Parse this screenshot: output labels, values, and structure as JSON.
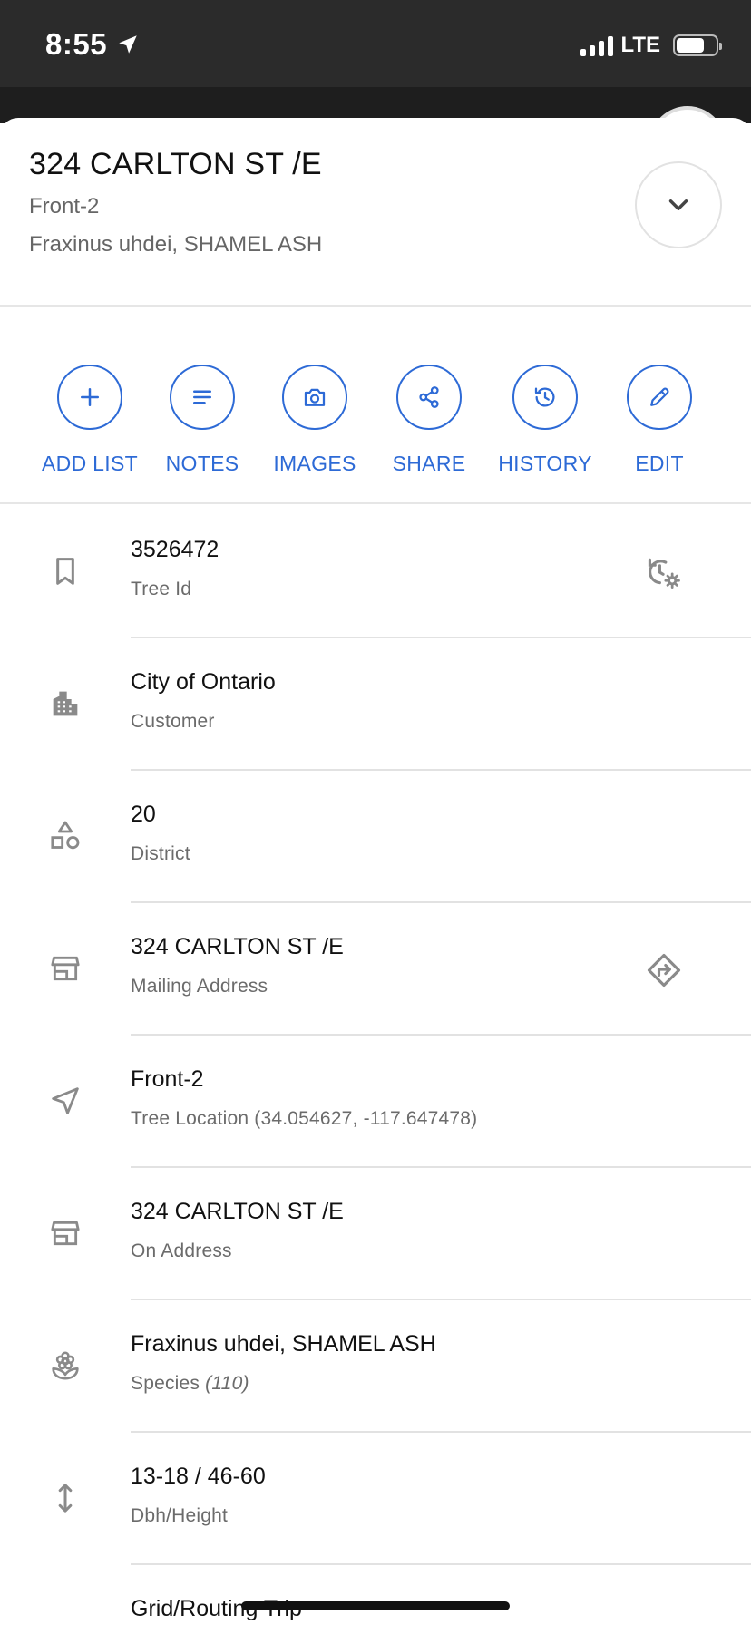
{
  "status_bar": {
    "time": "8:55",
    "network": "LTE"
  },
  "header": {
    "title": "324 CARLTON ST /E",
    "location": "Front-2",
    "species": "Fraxinus uhdei, SHAMEL ASH"
  },
  "actions": [
    {
      "label": "ADD LIST",
      "icon": "plus-icon"
    },
    {
      "label": "NOTES",
      "icon": "notes-icon"
    },
    {
      "label": "IMAGES",
      "icon": "camera-icon"
    },
    {
      "label": "SHARE",
      "icon": "share-icon"
    },
    {
      "label": "HISTORY",
      "icon": "history-icon"
    },
    {
      "label": "EDIT",
      "icon": "pencil-icon"
    }
  ],
  "details": [
    {
      "value": "3526472",
      "caption": "Tree Id",
      "icon": "bookmark-icon",
      "trailing_icon": "history-settings-icon"
    },
    {
      "value": "City of Ontario",
      "caption": "Customer",
      "icon": "building-icon"
    },
    {
      "value": "20",
      "caption": "District",
      "icon": "shapes-icon"
    },
    {
      "value": "324 CARLTON ST /E",
      "caption": "Mailing Address",
      "icon": "store-icon",
      "trailing_icon": "directions-icon"
    },
    {
      "value": "Front-2",
      "caption": "Tree Location (34.054627, -117.647478)",
      "icon": "navigation-icon"
    },
    {
      "value": "324 CARLTON ST /E",
      "caption": "On Address",
      "icon": "store-icon"
    },
    {
      "value": "Fraxinus uhdei, SHAMEL ASH",
      "caption": "Species",
      "caption_extra": "(110)",
      "icon": "flower-icon"
    },
    {
      "value": "13-18 / 46-60",
      "caption": "Dbh/Height",
      "icon": "vertical-arrows-icon"
    },
    {
      "value": "Grid/Routing Trip",
      "caption": "",
      "icon": "grid-icon"
    }
  ],
  "colors": {
    "accent": "#2d6ad6",
    "icon_gray": "#8a8a8a",
    "status_bar_bg": "#2b2b2b"
  }
}
